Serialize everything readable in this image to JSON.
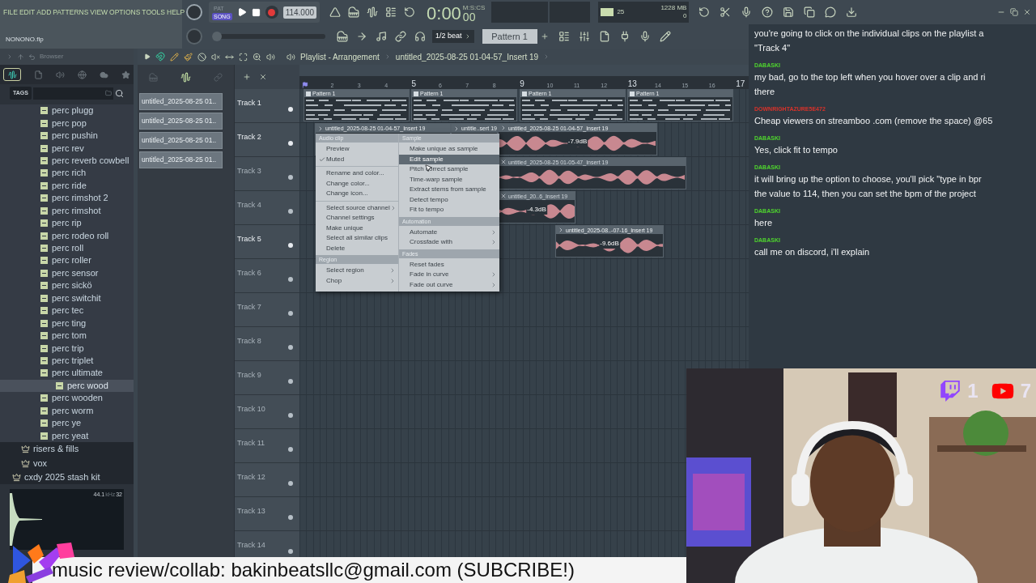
{
  "menu_bar": [
    "FILE",
    "EDIT",
    "ADD",
    "PATTERNS",
    "VIEW",
    "OPTIONS",
    "TOOLS",
    "HELP"
  ],
  "project_name": "NONONO.flp",
  "transport": {
    "modes": [
      {
        "label": "PAT",
        "selected": false
      },
      {
        "label": "SONG",
        "selected": true
      }
    ],
    "tempo": "114.000",
    "time": "0:00",
    "time_fraction": "00",
    "time_format": "M:S:CS"
  },
  "monitor": {
    "cpu": "25",
    "memory": "1228 MB",
    "polyphony": "0"
  },
  "song_position": {
    "level": 0
  },
  "snap": "1/2 beat",
  "pattern": "Pattern 1",
  "browser": {
    "title": "Browser",
    "tags_label": "TAGS",
    "tree": [
      {
        "kind": "group",
        "children": [
          {
            "kind": "group",
            "children": [
              {
                "kind": "sample",
                "label": "perc plugg",
                "selected": false
              },
              {
                "kind": "sample",
                "label": "perc pop",
                "selected": false
              },
              {
                "kind": "sample",
                "label": "perc pushin",
                "selected": false
              },
              {
                "kind": "sample",
                "label": "perc rev",
                "selected": false
              },
              {
                "kind": "sample",
                "label": "perc reverb cowbell",
                "selected": false
              },
              {
                "kind": "sample",
                "label": "perc rich",
                "selected": false
              },
              {
                "kind": "sample",
                "label": "perc ride",
                "selected": false
              },
              {
                "kind": "sample",
                "label": "perc rimshot 2",
                "selected": false
              },
              {
                "kind": "sample",
                "label": "perc rimshot",
                "selected": false
              },
              {
                "kind": "sample",
                "label": "perc rip",
                "selected": false
              },
              {
                "kind": "sample",
                "label": "perc rodeo roll",
                "selected": false
              },
              {
                "kind": "sample",
                "label": "perc roll",
                "selected": false
              },
              {
                "kind": "sample",
                "label": "perc roller",
                "selected": false
              },
              {
                "kind": "sample",
                "label": "perc sensor",
                "selected": false
              },
              {
                "kind": "sample",
                "label": "perc sickö",
                "selected": false
              },
              {
                "kind": "sample",
                "label": "perc switchit",
                "selected": false
              },
              {
                "kind": "sample",
                "label": "perc tec",
                "selected": false
              },
              {
                "kind": "sample",
                "label": "perc ting",
                "selected": false
              },
              {
                "kind": "sample",
                "label": "perc tom",
                "selected": false
              },
              {
                "kind": "sample",
                "label": "perc trip",
                "selected": false
              },
              {
                "kind": "sample",
                "label": "perc triplet",
                "selected": false
              },
              {
                "kind": "sample",
                "label": "perc ultimate",
                "selected": false
              },
              {
                "kind": "sample",
                "label": "perc wood",
                "selected": true
              },
              {
                "kind": "sample",
                "label": "perc wooden",
                "selected": false
              },
              {
                "kind": "sample",
                "label": "perc worm",
                "selected": false
              },
              {
                "kind": "sample",
                "label": "perc ye",
                "selected": false
              },
              {
                "kind": "sample",
                "label": "perc yeat",
                "selected": false
              }
            ]
          },
          {
            "kind": "pack",
            "label": "risers & fills"
          },
          {
            "kind": "pack",
            "label": "vox"
          }
        ]
      },
      {
        "kind": "pack",
        "label": "cxdy 2025 stash kit"
      }
    ],
    "sample_info": {
      "rate": "44.1",
      "unit": "kHz",
      "bits": "32"
    }
  },
  "clip_list": [
    "untitled_2025-08-25 01..",
    "untitled_2025-08-25 01..",
    "untitled_2025-08-25 01..",
    "untitled_2025-08-25 01.."
  ],
  "playlist": {
    "title": "Playlist - Arrangement",
    "breadcrumb": "untitled_2025-08-25 01-04-57_Insert 19",
    "ruler": [
      {
        "label": "2",
        "major": false
      },
      {
        "label": "3",
        "major": false
      },
      {
        "label": "4",
        "major": false
      },
      {
        "label": "5",
        "major": true
      },
      {
        "label": "6",
        "major": false
      },
      {
        "label": "7",
        "major": false
      },
      {
        "label": "8",
        "major": false
      },
      {
        "label": "9",
        "major": true
      },
      {
        "label": "10",
        "major": false
      },
      {
        "label": "11",
        "major": false
      },
      {
        "label": "12",
        "major": false
      },
      {
        "label": "13",
        "major": true
      },
      {
        "label": "14",
        "major": false
      },
      {
        "label": "15",
        "major": false
      },
      {
        "label": "16",
        "major": false
      },
      {
        "label": "17",
        "major": true
      }
    ],
    "tracks": [
      {
        "name": "Track 1",
        "active": true,
        "clips": [
          {
            "kind": "pattern",
            "label": "Pattern 1"
          },
          {
            "kind": "pattern",
            "label": "Pattern 1"
          },
          {
            "kind": "pattern",
            "label": "Pattern 1"
          },
          {
            "kind": "pattern",
            "label": "Pattern 1"
          }
        ]
      },
      {
        "name": "Track 2",
        "active": true,
        "clips": [
          {
            "kind": "audio",
            "label": "untitled_2025-08-25 01-04-57_Insert 19",
            "muted": false
          },
          {
            "kind": "audio",
            "label": "untitle..sert 19",
            "muted": false
          },
          {
            "kind": "audio",
            "label": "untitled_2025-08-25 01-04-57_Insert 19",
            "muted": false,
            "gain": "-7.9dB"
          }
        ]
      },
      {
        "name": "Track 3",
        "active": false,
        "clips": [
          {
            "kind": "audio",
            "label": "untitled_2025-08-25 01-05-47_Insert 19",
            "muted": true
          }
        ]
      },
      {
        "name": "Track 4",
        "active": false,
        "clips": [
          {
            "kind": "audio",
            "label": "untitled_20..6_Insert 19",
            "muted": true,
            "gain": "-4.3dB"
          }
        ]
      },
      {
        "name": "Track 5",
        "active": true,
        "clips": [
          {
            "kind": "audio",
            "label": "untitled_2025-08..-07-16_Insert 19",
            "muted": false,
            "gain": "-9.6dB"
          }
        ]
      },
      {
        "name": "Track 6",
        "active": false
      },
      {
        "name": "Track 7",
        "active": false
      },
      {
        "name": "Track 8",
        "active": false
      },
      {
        "name": "Track 9",
        "active": false
      },
      {
        "name": "Track 10",
        "active": false
      },
      {
        "name": "Track 11",
        "active": false
      },
      {
        "name": "Track 12",
        "active": false
      },
      {
        "name": "Track 13",
        "active": false
      },
      {
        "name": "Track 14",
        "active": false
      }
    ]
  },
  "context_menu": {
    "columns": [
      {
        "sections": [
          {
            "header": "Audio clip",
            "groups": [
              [
                {
                  "label": "Preview",
                  "checked": false,
                  "highlighted": false,
                  "submenu": false
                },
                {
                  "label": "Muted",
                  "checked": true,
                  "highlighted": false,
                  "submenu": false
                }
              ],
              [
                {
                  "label": "Rename and color...",
                  "checked": false,
                  "highlighted": false,
                  "submenu": false
                },
                {
                  "label": "Change color...",
                  "checked": false,
                  "highlighted": false,
                  "submenu": false
                },
                {
                  "label": "Change icon...",
                  "checked": false,
                  "highlighted": false,
                  "submenu": false
                }
              ],
              [
                {
                  "label": "Select source channel",
                  "checked": false,
                  "highlighted": false,
                  "submenu": true
                },
                {
                  "label": "Channel settings",
                  "checked": false,
                  "highlighted": false,
                  "submenu": false
                },
                {
                  "label": "Make unique",
                  "checked": false,
                  "highlighted": false,
                  "submenu": false
                },
                {
                  "label": "Select all similar clips",
                  "checked": false,
                  "highlighted": false,
                  "submenu": false
                },
                {
                  "label": "Delete",
                  "checked": false,
                  "highlighted": false,
                  "submenu": false
                }
              ]
            ]
          },
          {
            "header": "Region",
            "groups": [
              [
                {
                  "label": "Select region",
                  "checked": false,
                  "highlighted": false,
                  "submenu": true
                },
                {
                  "label": "Chop",
                  "checked": false,
                  "highlighted": false,
                  "submenu": true
                }
              ]
            ]
          }
        ]
      },
      {
        "sections": [
          {
            "header": "Sample",
            "groups": [
              [
                {
                  "label": "Make unique as sample",
                  "checked": false,
                  "highlighted": false,
                  "submenu": false
                },
                {
                  "label": "Edit sample",
                  "checked": false,
                  "highlighted": true,
                  "submenu": false
                },
                {
                  "label": "Pitch correct sample",
                  "checked": false,
                  "highlighted": false,
                  "submenu": false
                },
                {
                  "label": "Time-warp sample",
                  "checked": false,
                  "highlighted": false,
                  "submenu": false
                },
                {
                  "label": "Extract stems from sample",
                  "checked": false,
                  "highlighted": false,
                  "submenu": false
                },
                {
                  "label": "Detect tempo",
                  "checked": false,
                  "highlighted": false,
                  "submenu": false
                },
                {
                  "label": "Fit to tempo",
                  "checked": false,
                  "highlighted": false,
                  "submenu": false
                }
              ]
            ]
          },
          {
            "header": "Automation",
            "groups": [
              [
                {
                  "label": "Automate",
                  "checked": false,
                  "highlighted": false,
                  "submenu": true
                },
                {
                  "label": "Crossfade with",
                  "checked": false,
                  "highlighted": false,
                  "submenu": true
                }
              ]
            ]
          },
          {
            "header": "Fades",
            "groups": [
              [
                {
                  "label": "Reset fades",
                  "checked": false,
                  "highlighted": false,
                  "submenu": false
                },
                {
                  "label": "Fade in curve",
                  "checked": false,
                  "highlighted": false,
                  "submenu": true
                },
                {
                  "label": "Fade out curve",
                  "checked": false,
                  "highlighted": false,
                  "submenu": true
                }
              ]
            ]
          }
        ]
      }
    ]
  },
  "chat": [
    {
      "lines": [
        "you're going to click on the individual clips on the playlist a",
        "\"Track 4\""
      ]
    },
    {
      "author": "DABASKI",
      "color": "#4fd62e",
      "lines": [
        "my bad, go to the top left when you hover over a clip and ri",
        "there"
      ]
    },
    {
      "author": "DOWNRIGHTAZURE5E472",
      "color": "#d8322a",
      "lines": [
        "Cheap viewers on streamboo .com (remove the space) @65"
      ]
    },
    {
      "author": "DABASKI",
      "color": "#4fd62e",
      "lines": [
        "Yes, click fit to tempo"
      ]
    },
    {
      "author": "DABASKI",
      "color": "#4fd62e",
      "lines": [
        "it will bring up the option to choose, you'll pick \"type in bpr",
        "the value to 114, then you can set the bpm of the project"
      ]
    },
    {
      "author": "DABASKI",
      "color": "#4fd62e",
      "lines": [
        "here"
      ]
    },
    {
      "author": "DABASKI",
      "color": "#4fd62e",
      "lines": [
        "call me on discord, i'll explain"
      ]
    }
  ],
  "stream": {
    "counters": [
      {
        "kind": "twitch",
        "count": "1"
      },
      {
        "kind": "youtube",
        "count": "7"
      }
    ]
  },
  "banner": "music review/collab: bakinbeatsllc@gmail.com (SUBCRIBE!)"
}
